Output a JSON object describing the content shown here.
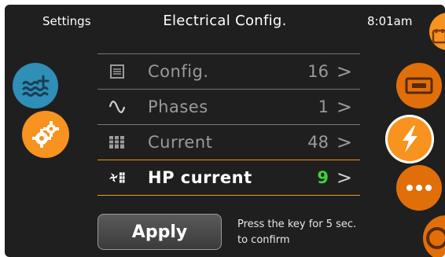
{
  "header": {
    "back_label": "Settings",
    "title": "Electrical Config.",
    "time": "8:01am"
  },
  "menu": {
    "items": [
      {
        "icon": "list-icon",
        "label": "Config.",
        "value": "16",
        "active": false
      },
      {
        "icon": "sine-wave-icon",
        "label": "Phases",
        "value": "1",
        "active": false
      },
      {
        "icon": "meter-icon",
        "label": "Current",
        "value": "48",
        "active": false
      },
      {
        "icon": "heat-pump-icon",
        "label": "HP current",
        "value": "9",
        "active": true
      }
    ],
    "chevron": ">"
  },
  "apply": {
    "label": "Apply"
  },
  "hint": {
    "text": "Press the key for 5 sec. to confirm"
  },
  "side_buttons": {
    "left": [
      "spa-heat-icon",
      "gear-icon"
    ],
    "right": [
      "calendar-icon",
      "display-icon",
      "lightning-icon",
      "more-icon",
      "power-icon"
    ]
  },
  "colors": {
    "background": "#1f1f1f",
    "accent": "#f7931e",
    "accent_dark": "#e06f0a",
    "spa_blue": "#2f8fb6",
    "value_active": "#3cd23c"
  }
}
